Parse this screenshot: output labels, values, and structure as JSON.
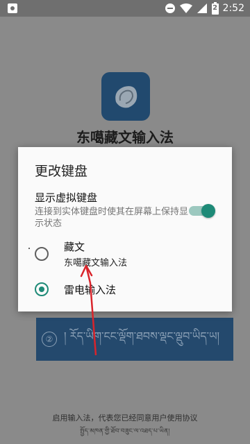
{
  "status_bar": {
    "time": "2:52",
    "battery_level": "2",
    "icons": [
      "notification-icon",
      "minus-circle-icon",
      "wifi-icon",
      "signal-icon",
      "battery-icon"
    ]
  },
  "background_app": {
    "title": "东噶藏文输入法",
    "step_number": "②",
    "step_text": "། ཪོད་ཡིག་ངང་ལྡོག་ཐབས་ལྡང་ལྡུབ་ཡིད་ཡ།",
    "footer_line1": "启用输入法，代表您已经同意用户使用协议",
    "footer_line2": "སྤྱོད་མཁན་གྱི་ཐོབ་བཟུང་ལ་འཐད་པ་ཡིན།"
  },
  "dialog": {
    "title": "更改键盘",
    "virtual_keyboard": {
      "title": "显示虚拟键盘",
      "subtitle": "连接到实体键盘时使其在屏幕上保持显示状态",
      "enabled": true
    },
    "options": [
      {
        "label": "藏文",
        "sublabel": "东噶藏文输入法",
        "selected": false
      },
      {
        "label": "雷电输入法",
        "sublabel": "",
        "selected": true
      }
    ]
  },
  "colors": {
    "accent": "#1e8a77",
    "logo_bg": "#21496e",
    "annotation": "#d9242b"
  }
}
